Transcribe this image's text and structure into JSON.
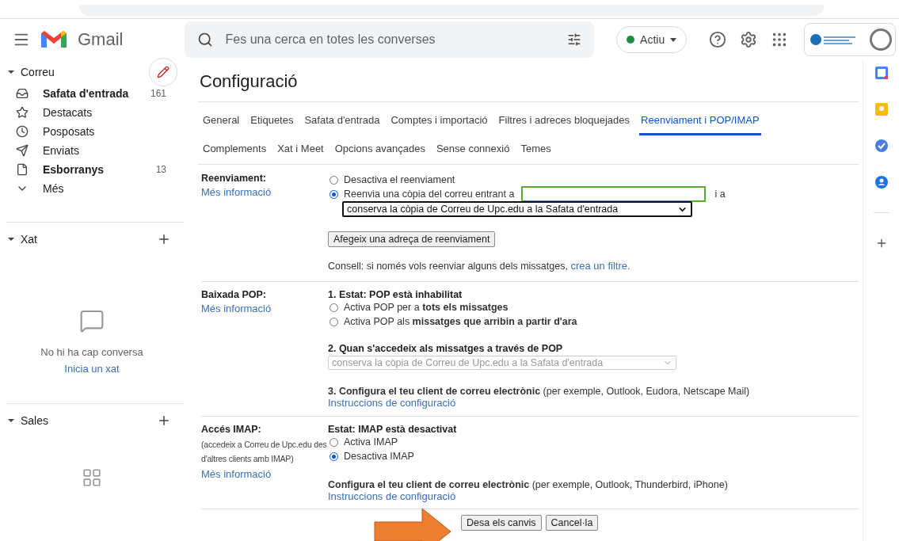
{
  "header": {
    "app_name": "Gmail",
    "search_placeholder": "Fes una cerca en totes les converses",
    "status": {
      "label": "Actiu",
      "color": "#1e8e3e"
    }
  },
  "sidebar": {
    "mail": {
      "title": "Correu",
      "expanded": true,
      "items": [
        {
          "kind": "inbox",
          "label": "Safata d'entrada",
          "count": "161",
          "unread": true
        },
        {
          "kind": "star",
          "label": "Destacats",
          "unread": false
        },
        {
          "kind": "clock",
          "label": "Posposats",
          "unread": false
        },
        {
          "kind": "send",
          "label": "Enviats",
          "unread": false
        },
        {
          "kind": "file",
          "label": "Esborranys",
          "count": "13",
          "unread": true
        },
        {
          "kind": "more",
          "label": "Més",
          "unread": false
        }
      ]
    },
    "chat": {
      "title": "Xat",
      "expanded": true,
      "empty_text": "No hi ha cap conversa",
      "link": "Inicia un xat"
    },
    "rooms": {
      "title": "Sales",
      "expanded": true
    }
  },
  "settings": {
    "title": "Configuració",
    "tab_rows": [
      [
        {
          "label": "General",
          "selected": false
        },
        {
          "label": "Etiquetes",
          "selected": false
        },
        {
          "label": "Safata d'entrada",
          "selected": false
        },
        {
          "label": "Comptes i importació",
          "selected": false
        },
        {
          "label": "Filtres i adreces bloquejades",
          "selected": false
        },
        {
          "label": "Reenviament i POP/IMAP",
          "selected": true
        }
      ],
      [
        {
          "label": "Complements",
          "selected": false
        },
        {
          "label": "Xat i Meet",
          "selected": false
        },
        {
          "label": "Opcions avançades",
          "selected": false
        },
        {
          "label": "Sense connexió",
          "selected": false
        },
        {
          "label": "Temes",
          "selected": false
        }
      ]
    ],
    "forwarding": {
      "label": "Reenviament:",
      "more": "Més informació",
      "options": [
        {
          "label": "Desactiva el reenviament",
          "selected": false
        },
        {
          "label": "Reenvia una còpia del correu entrant a",
          "selected": true
        }
      ],
      "and_text": "i a",
      "keep_select": "conserva la còpia de Correu de Upc.edu a la Safata d'entrada",
      "add_button": "Afegeix una adreça de reenviament",
      "tip": "Consell: si només vols reenviar alguns dels missatges,",
      "tip_link": "crea un filtre."
    },
    "pop": {
      "label": "Baixada POP:",
      "more": "Més informació",
      "status": "1. Estat: POP està inhabilitat",
      "options": [
        {
          "label": "Activa POP per a **tots els missatges**",
          "selected": false
        },
        {
          "label": "Activa POP als **missatges que arribin a partir d'ara**",
          "selected": false
        }
      ],
      "step2": "2. Quan s'accedeix als missatges a través de POP",
      "select": {
        "value": "conserva la còpia de Correu de Upc.edu a la Safata d'entrada",
        "disabled": true
      },
      "step3": "**3. Configura el teu client de correu electrònic** (per exemple, Outlook, Eudora, Netscape Mail)",
      "instructions": "Instruccions de configuració"
    },
    "imap": {
      "label": "Accés IMAP:",
      "note": "(accedeix a Correu de Upc.edu des d'altres clients amb IMAP)",
      "more": "Més informació",
      "status": "Estat: IMAP està desactivat",
      "options": [
        {
          "label": "Activa IMAP",
          "selected": false
        },
        {
          "label": "Desactiva IMAP",
          "selected": true
        }
      ],
      "configure": "**Configura el teu client de correu electrònic** (per exemple, Outlook, Thunderbird, iPhone)",
      "instructions": "Instruccions de configuració"
    },
    "buttons": [
      "Desa els canvis",
      "Cancel·la"
    ]
  }
}
